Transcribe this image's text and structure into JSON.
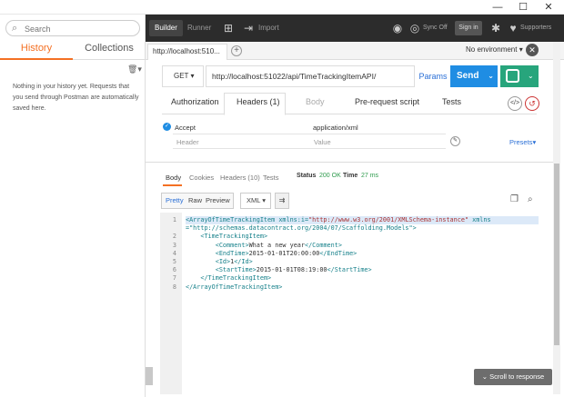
{
  "window": {
    "minimize": "—",
    "maximize": "☐",
    "close": "✕"
  },
  "sidebar": {
    "search_placeholder": "Search",
    "tabs": [
      {
        "label": "History"
      },
      {
        "label": "Collections"
      }
    ],
    "empty_message": "Nothing in your history yet. Requests that you send through Postman are automatically saved here."
  },
  "toolbar": {
    "builder": "Builder",
    "runner": "Runner",
    "import": "Import",
    "sync": "Sync Off",
    "signin": "Sign in",
    "supporters": "Supporters"
  },
  "request_tabs": {
    "active_tab": "http://localhost:510...",
    "environment": "No environment"
  },
  "request": {
    "method": "GET",
    "url": "http://localhost:51022/api/TimeTrackingItemAPI/",
    "params_label": "Params",
    "send_label": "Send"
  },
  "request_subtabs": [
    {
      "label": "Authorization"
    },
    {
      "label": "Headers (1)"
    },
    {
      "label": "Body"
    },
    {
      "label": "Pre-request script"
    },
    {
      "label": "Tests"
    }
  ],
  "headers": {
    "rows": [
      {
        "key": "Accept",
        "value": "application/xml"
      }
    ],
    "key_placeholder": "Header",
    "value_placeholder": "Value",
    "presets_label": "Presets"
  },
  "response": {
    "tabs": [
      {
        "label": "Body"
      },
      {
        "label": "Cookies"
      },
      {
        "label": "Headers (10)"
      },
      {
        "label": "Tests"
      }
    ],
    "status_label": "Status",
    "status_value": "200 OK",
    "time_label": "Time",
    "time_value": "27 ms",
    "format_buttons": [
      {
        "label": "Pretty"
      },
      {
        "label": "Raw"
      },
      {
        "label": "Preview"
      }
    ],
    "language": "XML",
    "scroll_button": "Scroll to response",
    "code_lines": [
      {
        "n": "1",
        "parts": [
          {
            "c": "tag",
            "t": "<ArrayOfTimeTrackingItem "
          },
          {
            "c": "attr",
            "t": "xmlns:i="
          },
          {
            "c": "str",
            "t": "\"http://www.w3.org/2001/XMLSchema-instance\""
          },
          {
            "c": "attr",
            "t": " xmlns"
          }
        ]
      },
      {
        "n": "",
        "parts": [
          {
            "c": "attr",
            "t": "=\"http://schemas.datacontract.org/2004/07/Scaffolding.Models\""
          },
          {
            "c": "tag",
            "t": ">"
          }
        ]
      },
      {
        "n": "2",
        "parts": [
          {
            "c": "text",
            "t": "    "
          },
          {
            "c": "tag",
            "t": "<TimeTrackingItem>"
          }
        ]
      },
      {
        "n": "3",
        "parts": [
          {
            "c": "text",
            "t": "        "
          },
          {
            "c": "tag",
            "t": "<Comment>"
          },
          {
            "c": "text",
            "t": "What a new year"
          },
          {
            "c": "tag",
            "t": "</Comment>"
          }
        ]
      },
      {
        "n": "4",
        "parts": [
          {
            "c": "text",
            "t": "        "
          },
          {
            "c": "tag",
            "t": "<EndTime>"
          },
          {
            "c": "text",
            "t": "2015-01-01T20:00:00"
          },
          {
            "c": "tag",
            "t": "</EndTime>"
          }
        ]
      },
      {
        "n": "5",
        "parts": [
          {
            "c": "text",
            "t": "        "
          },
          {
            "c": "tag",
            "t": "<Id>"
          },
          {
            "c": "text",
            "t": "1"
          },
          {
            "c": "tag",
            "t": "</Id>"
          }
        ]
      },
      {
        "n": "6",
        "parts": [
          {
            "c": "text",
            "t": "        "
          },
          {
            "c": "tag",
            "t": "<StartTime>"
          },
          {
            "c": "text",
            "t": "2015-01-01T08:19:00"
          },
          {
            "c": "tag",
            "t": "</StartTime>"
          }
        ]
      },
      {
        "n": "7",
        "parts": [
          {
            "c": "text",
            "t": "    "
          },
          {
            "c": "tag",
            "t": "</TimeTrackingItem>"
          }
        ]
      },
      {
        "n": "8",
        "parts": [
          {
            "c": "tag",
            "t": "</ArrayOfTimeTrackingItem>"
          }
        ]
      }
    ]
  },
  "colors": {
    "accent": "#f47023",
    "send": "#1f8de3",
    "save": "#27a57c",
    "status_ok": "#2e9b4d"
  }
}
